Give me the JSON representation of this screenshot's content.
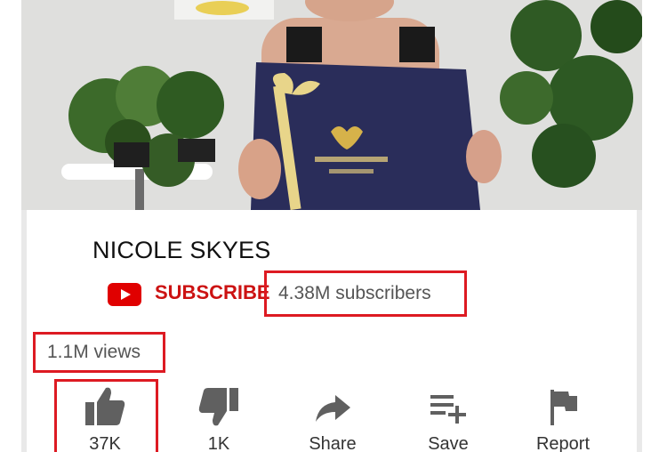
{
  "channel": {
    "name": "NICOLE SKYES",
    "subscribe_label": "SUBSCRIBE",
    "subscribers": "4.38M subscribers"
  },
  "video": {
    "views": "1.1M views",
    "thumbnail_icon": "gift-box-image"
  },
  "actions": [
    {
      "label": "37K",
      "icon": "thumbs-up-icon"
    },
    {
      "label": "1K",
      "icon": "thumbs-down-icon"
    },
    {
      "label": "Share",
      "icon": "share-icon"
    },
    {
      "label": "Save",
      "icon": "playlist-add-icon"
    },
    {
      "label": "Report",
      "icon": "flag-icon"
    }
  ],
  "colors": {
    "brand_red": "#e00000",
    "highlight_box": "#dd1a22",
    "gift_box": "#2a2d5a",
    "ribbon_gold": "#e8d58a"
  }
}
